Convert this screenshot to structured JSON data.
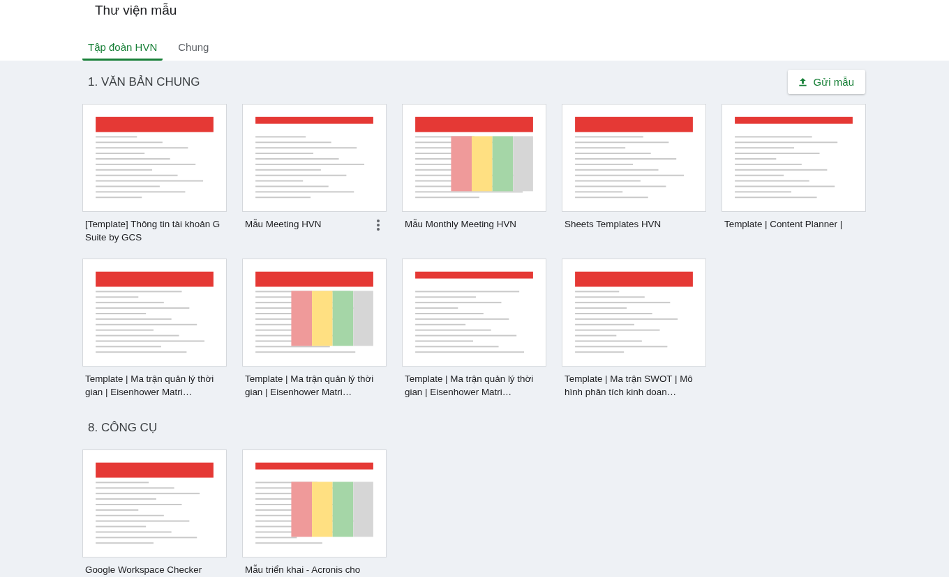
{
  "header": {
    "title": "Thư viện mẫu"
  },
  "tabs": [
    {
      "label": "Tập đoàn HVN",
      "selected": true
    },
    {
      "label": "Chung",
      "selected": false
    }
  ],
  "sections": [
    {
      "heading": "1. VĂN BẢN CHUNG",
      "action": "Gửi mẫu",
      "templates": [
        {
          "title": "[Template] Thông tin tài khoản G Suite by GCS",
          "menu_shown": false
        },
        {
          "title": "Mẫu Meeting HVN",
          "menu_shown": true
        },
        {
          "title": "Mẫu Monthly Meeting HVN",
          "menu_shown": false
        },
        {
          "title": "Sheets Templates HVN",
          "menu_shown": false
        },
        {
          "title": "Template | Content Planner |",
          "menu_shown": false
        },
        {
          "title": "Template | Ma trận quản lý thời gian | Eisenhower Matri…",
          "menu_shown": false
        },
        {
          "title": "Template | Ma trận quản lý thời gian | Eisenhower Matri…",
          "menu_shown": false
        },
        {
          "title": "Template | Ma trận quản lý thời gian | Eisenhower Matri…",
          "menu_shown": false
        },
        {
          "title": "Template | Ma trận SWOT | Mô hình phân tích kinh doan…",
          "menu_shown": false
        }
      ]
    },
    {
      "heading": "8. CÔNG CỤ",
      "templates": [
        {
          "title": "Google Workspace Checker",
          "menu_shown": false
        },
        {
          "title": "Mẫu triển khai - Acronis cho",
          "menu_shown": false
        }
      ]
    }
  ]
}
